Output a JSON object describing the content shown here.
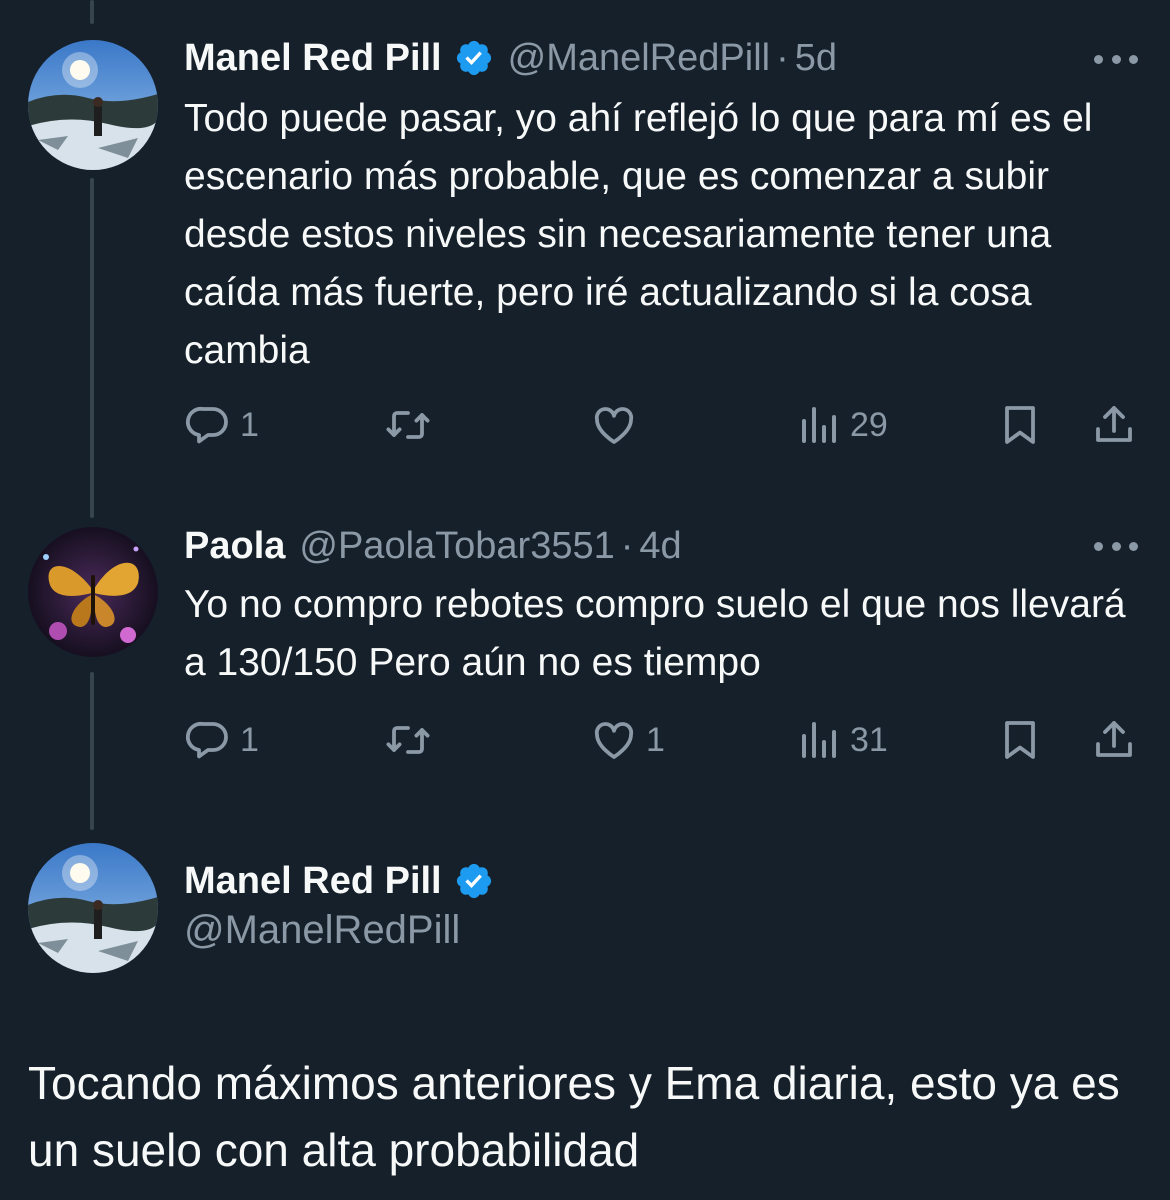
{
  "tweets": [
    {
      "name": "Manel Red Pill",
      "handle": "@ManelRedPill",
      "separator": "·",
      "time": "5d",
      "text": "Todo puede pasar, yo ahí reflejó lo que para mí es el escenario más probable, que es comenzar a subir desde estos niveles sin necesariamente tener una caída más fuerte, pero iré actualizando si la cosa cambia",
      "replies": "1",
      "retweets": "",
      "likes": "",
      "views": "29",
      "verified": true
    },
    {
      "name": "Paola",
      "handle": "@PaolaTobar3551",
      "separator": "·",
      "time": "4d",
      "text": "Yo no compro rebotes compro suelo el que nos llevará a 130/150 Pero aún no es tiempo",
      "replies": "1",
      "retweets": "",
      "likes": "1",
      "views": "31",
      "verified": false
    }
  ],
  "main_tweet": {
    "name": "Manel Red Pill",
    "handle": "@ManelRedPill",
    "text": "Tocando máximos anteriores y Ema diaria, esto ya es un suelo con alta probabilidad",
    "verified": true
  },
  "icons": {
    "reply": "reply-icon",
    "retweet": "retweet-icon",
    "like": "heart-icon",
    "views": "views-icon",
    "bookmark": "bookmark-icon",
    "share": "share-icon",
    "more": "more-icon",
    "verified": "verified-badge-icon"
  },
  "colors": {
    "background": "#15202b",
    "text": "#f7f9f9",
    "secondary": "#8b98a5",
    "verified": "#1d9bf0",
    "thread_line": "#38444d"
  }
}
